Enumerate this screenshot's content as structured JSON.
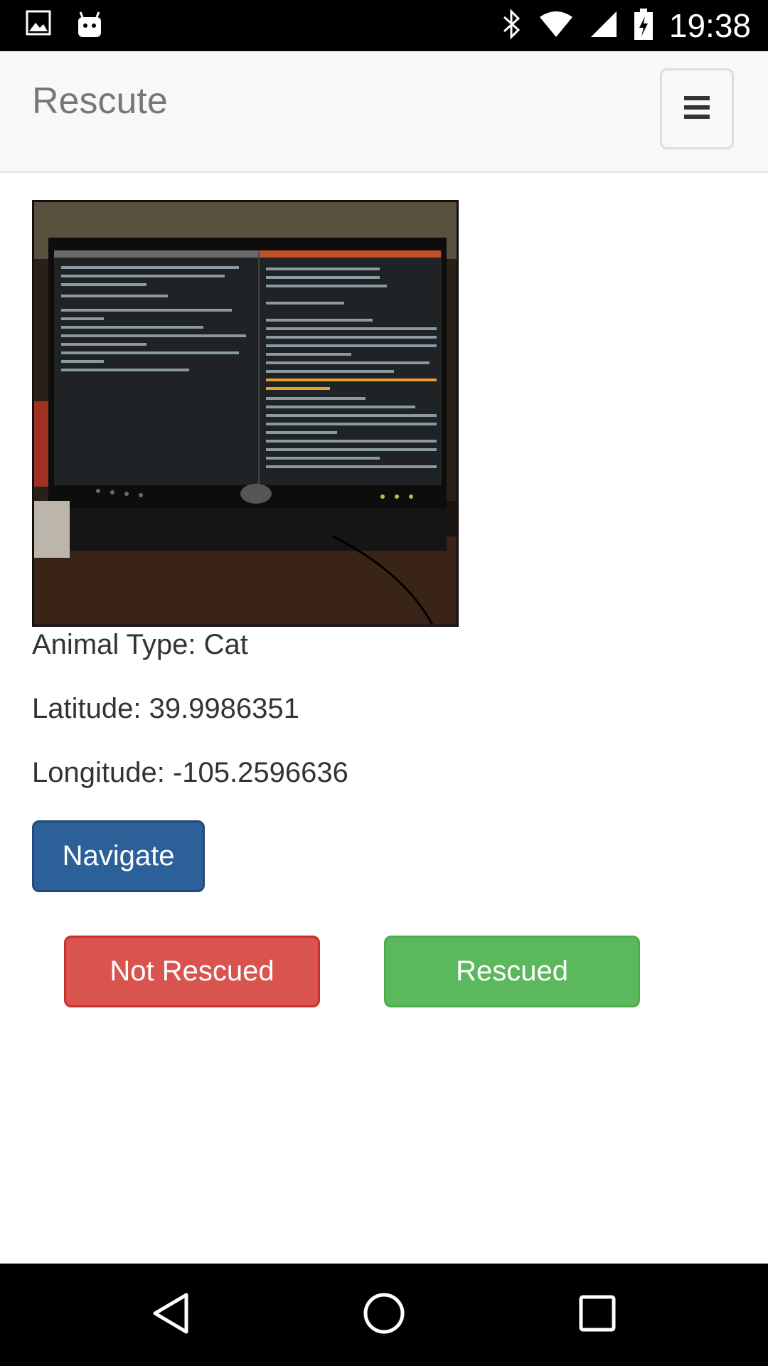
{
  "status_bar": {
    "time": "19:38",
    "left_icons": [
      "image-icon",
      "android-icon"
    ],
    "right_icons": [
      "bluetooth-icon",
      "wifi-icon",
      "signal-icon",
      "battery-charging-icon"
    ]
  },
  "navbar": {
    "brand": "Rescute",
    "menu_icon": "hamburger-icon"
  },
  "animal": {
    "photo_alt": "",
    "type_line": "Animal Type: Cat",
    "latitude_line": "Latitude: 39.9986351",
    "longitude_line": "Longitude: -105.2596636"
  },
  "actions": {
    "navigate_label": "Navigate",
    "not_rescued_label": "Not Rescued",
    "rescued_label": "Rescued"
  },
  "colors": {
    "navigate": "#2c6099",
    "not_rescued": "#d9534f",
    "rescued": "#5cb85c",
    "navbar_bg": "#f8f8f8"
  },
  "system_nav": {
    "back_icon": "back-icon",
    "home_icon": "home-icon",
    "recents_icon": "recents-icon"
  }
}
